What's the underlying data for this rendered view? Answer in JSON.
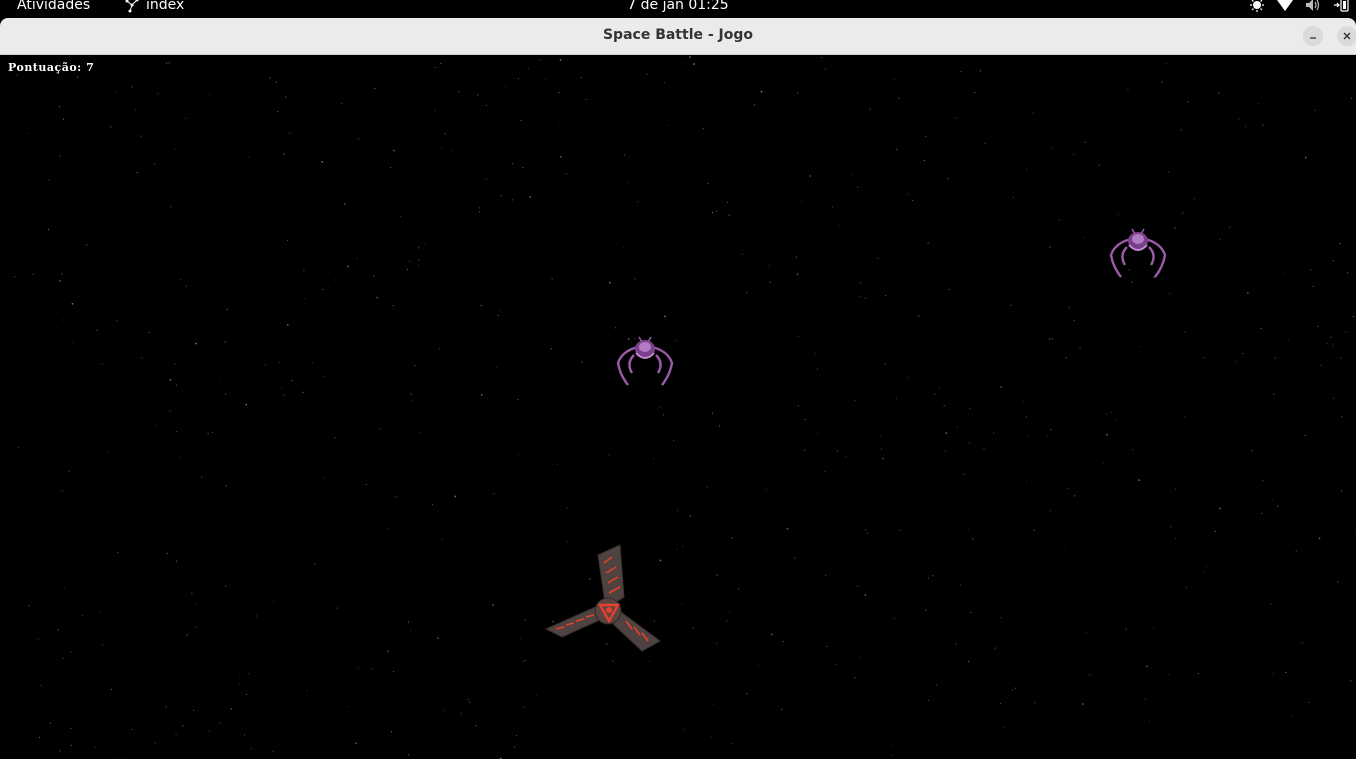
{
  "topbar": {
    "activities": "Atividades",
    "app_name": "index",
    "clock": "7 de jan  01:25",
    "tray_icons": [
      "accessibility-icon",
      "wifi-icon",
      "volume-muted-icon",
      "battery-icon"
    ]
  },
  "window": {
    "title": "Space Battle - Jogo",
    "minimize_symbol": "–",
    "close_symbol": "✕"
  },
  "game": {
    "score_text": "Pontuação: 7",
    "colors": {
      "background": "#000000",
      "star": "#8a8a8a",
      "enemy": "#9a5aa8",
      "player_hull": "#5a4a48",
      "player_accent": "#e8402a"
    },
    "enemies": [
      "enemy-ship",
      "enemy-ship"
    ],
    "player": "player-ship"
  }
}
